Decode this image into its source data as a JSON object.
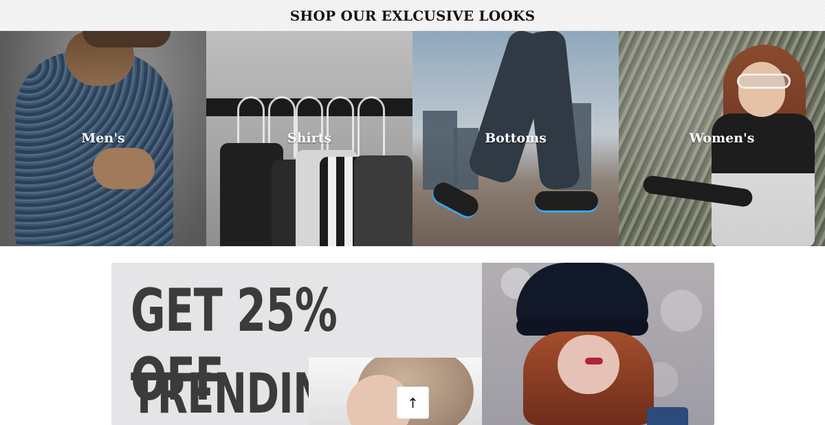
{
  "section": {
    "title": "SHOP OUR EXLCUSIVE LOOKS"
  },
  "categories": [
    {
      "label": "Men's"
    },
    {
      "label": "Shirts"
    },
    {
      "label": "Bottoms"
    },
    {
      "label": "Women's"
    }
  ],
  "promo": {
    "line1": "GET 25% OFF",
    "line2": "TRENDING"
  },
  "scroll_top": {
    "icon": "arrow-up-icon",
    "glyph": "↑"
  },
  "colors": {
    "title_text": "#141414",
    "promo_text": "#3b3b3b",
    "promo_bg": "#e5e5e7"
  }
}
